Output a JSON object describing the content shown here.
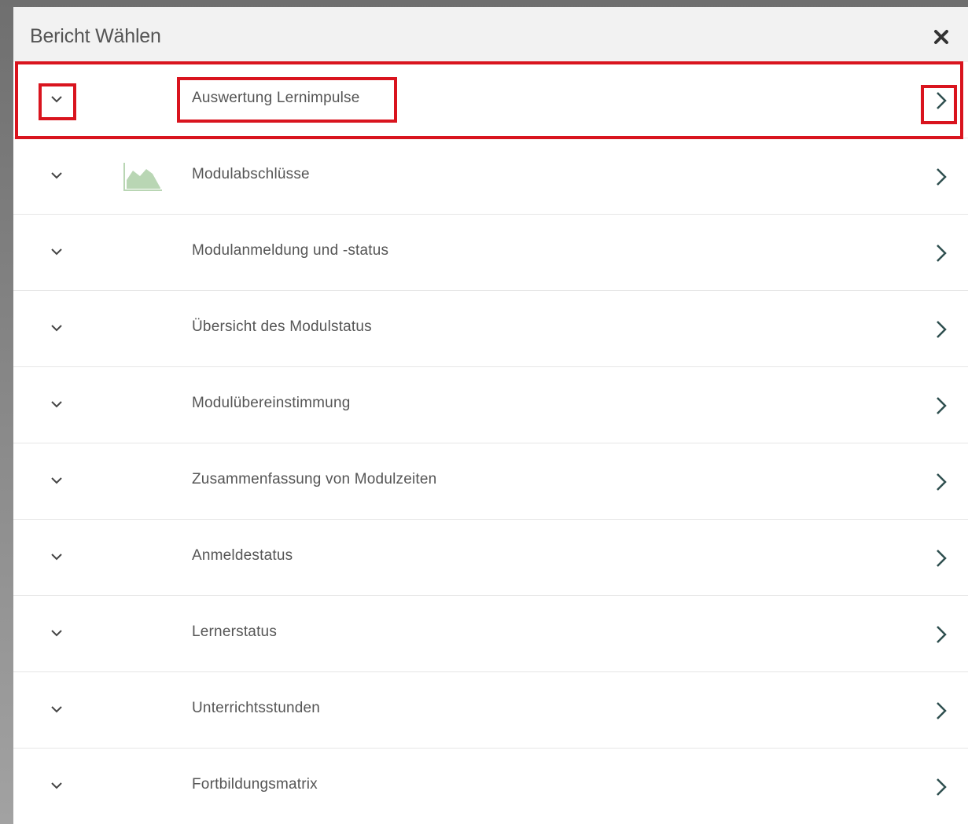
{
  "dialog": {
    "title": "Bericht Wählen",
    "close_icon": "close-icon"
  },
  "reports": [
    {
      "label": "Auswertung Lernimpulse",
      "icon": null,
      "highlighted": true
    },
    {
      "label": "Modulabschlüsse",
      "icon": "area-chart-icon",
      "highlighted": false
    },
    {
      "label": "Modulanmeldung und -status",
      "icon": null,
      "highlighted": false
    },
    {
      "label": "Übersicht des Modulstatus",
      "icon": null,
      "highlighted": false
    },
    {
      "label": "Modulübereinstimmung",
      "icon": null,
      "highlighted": false
    },
    {
      "label": "Zusammenfassung von Modulzeiten",
      "icon": null,
      "highlighted": false
    },
    {
      "label": "Anmeldestatus",
      "icon": null,
      "highlighted": false
    },
    {
      "label": "Lernerstatus",
      "icon": null,
      "highlighted": false
    },
    {
      "label": "Unterrichtsstunden",
      "icon": null,
      "highlighted": false
    },
    {
      "label": "Fortbildungsmatrix",
      "icon": null,
      "highlighted": false
    }
  ],
  "colors": {
    "highlight": "#d9141e",
    "chevron": "#2f4f4f",
    "chart_icon": "#b9d6b4",
    "text": "#555555"
  }
}
